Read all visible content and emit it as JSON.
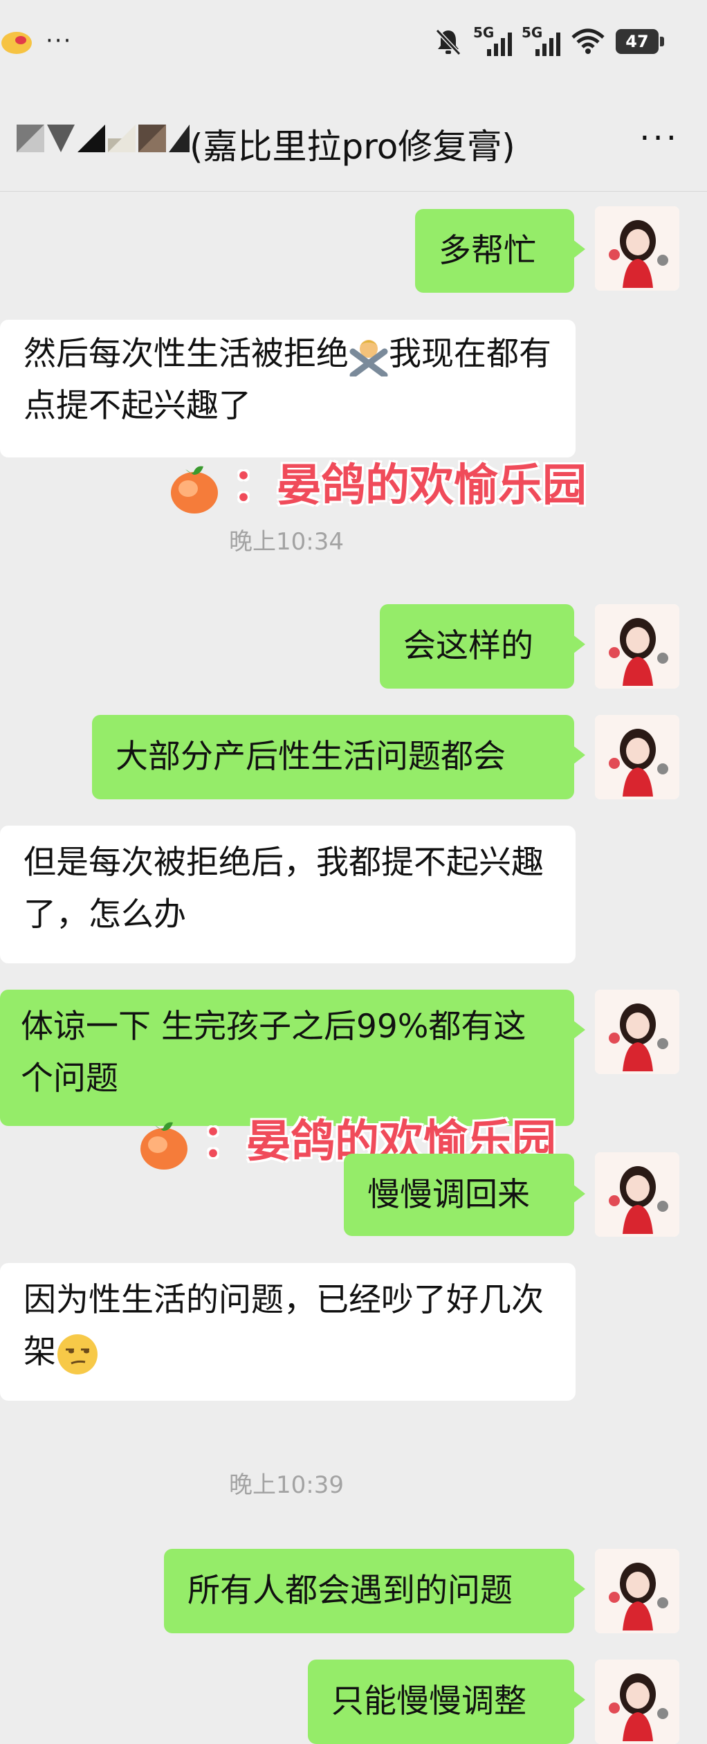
{
  "status_bar": {
    "more": "···",
    "signal1_label": "5G",
    "signal2_label": "5G",
    "battery": "47",
    "icons": [
      "notification-emoji-icon",
      "mute-bell-icon",
      "signal-icon",
      "signal-icon",
      "wifi-icon",
      "battery-icon"
    ]
  },
  "header": {
    "title": "(嘉比里拉pro修复膏)",
    "more_label": "···"
  },
  "colors": {
    "my_bubble": "#95ec69",
    "their_bubble": "#ffffff",
    "background": "#ededed",
    "watermark": "#f04b5a"
  },
  "messages": [
    {
      "side": "me",
      "text": "多帮忙"
    },
    {
      "side": "them",
      "text": "然后每次性生活被拒绝",
      "emoji": "person-gesturing-no-emoji",
      "text2": "我现在都有点提不起兴趣了"
    },
    {
      "side": "me",
      "text": "会这样的"
    },
    {
      "side": "me",
      "text": "大部分产后性生活问题都会"
    },
    {
      "side": "them",
      "text": "但是每次被拒绝后，我都提不起兴趣了，怎么办"
    },
    {
      "side": "me",
      "text": "体谅一下 生完孩子之后99%都有这个问题"
    },
    {
      "side": "me",
      "text": "慢慢调回来"
    },
    {
      "side": "them",
      "text": "因为性生活的问题，已经吵了好几次架",
      "emoji": "unamused-face-emoji"
    },
    {
      "side": "me",
      "text": "所有人都会遇到的问题"
    },
    {
      "side": "me",
      "text": "只能慢慢调整"
    }
  ],
  "timestamps": [
    "晚上10:34",
    "晚上10:39"
  ],
  "watermark": {
    "text": "：晏鸽的欢愉乐园"
  }
}
